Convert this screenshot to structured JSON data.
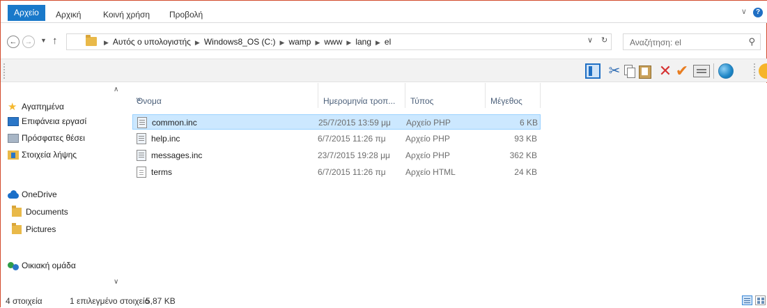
{
  "ribbon": {
    "tabs": [
      "Αρχείο",
      "Αρχική",
      "Κοινή χρήση",
      "Προβολή"
    ],
    "collapse_glyph": "∨",
    "help_glyph": "?"
  },
  "address": {
    "back_glyph": "←",
    "forward_glyph": "→",
    "recent_glyph": "▼",
    "up_glyph": "↑",
    "separator_glyph": "▶",
    "crumbs": [
      "Αυτός ο υπολογιστής",
      "Windows8_OS (C:)",
      "wamp",
      "www",
      "lang",
      "el"
    ],
    "dropdown_glyph": "∨",
    "refresh_glyph": "↻"
  },
  "search": {
    "placeholder": "Αναζήτηση: el",
    "icon": "search-icon",
    "glyph": "⚲"
  },
  "toolbar": {
    "icons": [
      "preview-pane-icon",
      "cut-icon",
      "copy-icon",
      "paste-icon",
      "delete-icon",
      "checkmark-icon",
      "properties-icon",
      "globe-icon"
    ],
    "cut_glyph": "✂",
    "delete_glyph": "✕",
    "check_glyph": "✔"
  },
  "nav_pane": {
    "scroll_up_glyph": "∧",
    "scroll_down_glyph": "∨",
    "items": [
      {
        "label": "Αγαπημένα",
        "icon": "star-icon"
      },
      {
        "label": "Επιφάνεια εργασί",
        "icon": "desktop-icon"
      },
      {
        "label": "Πρόσφατες θέσει",
        "icon": "recent-places-icon"
      },
      {
        "label": "Στοιχεία λήψης",
        "icon": "downloads-icon"
      },
      {
        "label": "OneDrive",
        "icon": "onedrive-icon"
      },
      {
        "label": "Documents",
        "icon": "folder-icon"
      },
      {
        "label": "Pictures",
        "icon": "folder-icon"
      },
      {
        "label": "Οικιακή ομάδα",
        "icon": "homegroup-icon"
      }
    ],
    "star_glyph": "★"
  },
  "file_list": {
    "columns": [
      "Όνομα",
      "Ημερομηνία τροπ...",
      "Τύπος",
      "Μέγεθος"
    ],
    "sort_glyph": "▲",
    "rows": [
      {
        "name": "common.inc",
        "date": "25/7/2015 13:59 μμ",
        "type": "Αρχείο PHP",
        "size": "6 KB",
        "selected": true
      },
      {
        "name": "help.inc",
        "date": "6/7/2015 11:26 πμ",
        "type": "Αρχείο PHP",
        "size": "93 KB",
        "selected": false
      },
      {
        "name": "messages.inc",
        "date": "23/7/2015 19:28 μμ",
        "type": "Αρχείο PHP",
        "size": "362 KB",
        "selected": false
      },
      {
        "name": "terms",
        "date": "6/7/2015 11:26 πμ",
        "type": "Αρχείο HTML",
        "size": "24 KB",
        "selected": false
      }
    ]
  },
  "status_bar": {
    "item_count": "4 στοιχεία",
    "selected_count": "1 επιλεγμένο στοιχείο",
    "selected_size": "5,87 KB"
  },
  "colors": {
    "accent": "#1979ca",
    "selection_bg": "#cce8ff",
    "selection_border": "#99d1ff",
    "window_border": "#d24a2b"
  }
}
